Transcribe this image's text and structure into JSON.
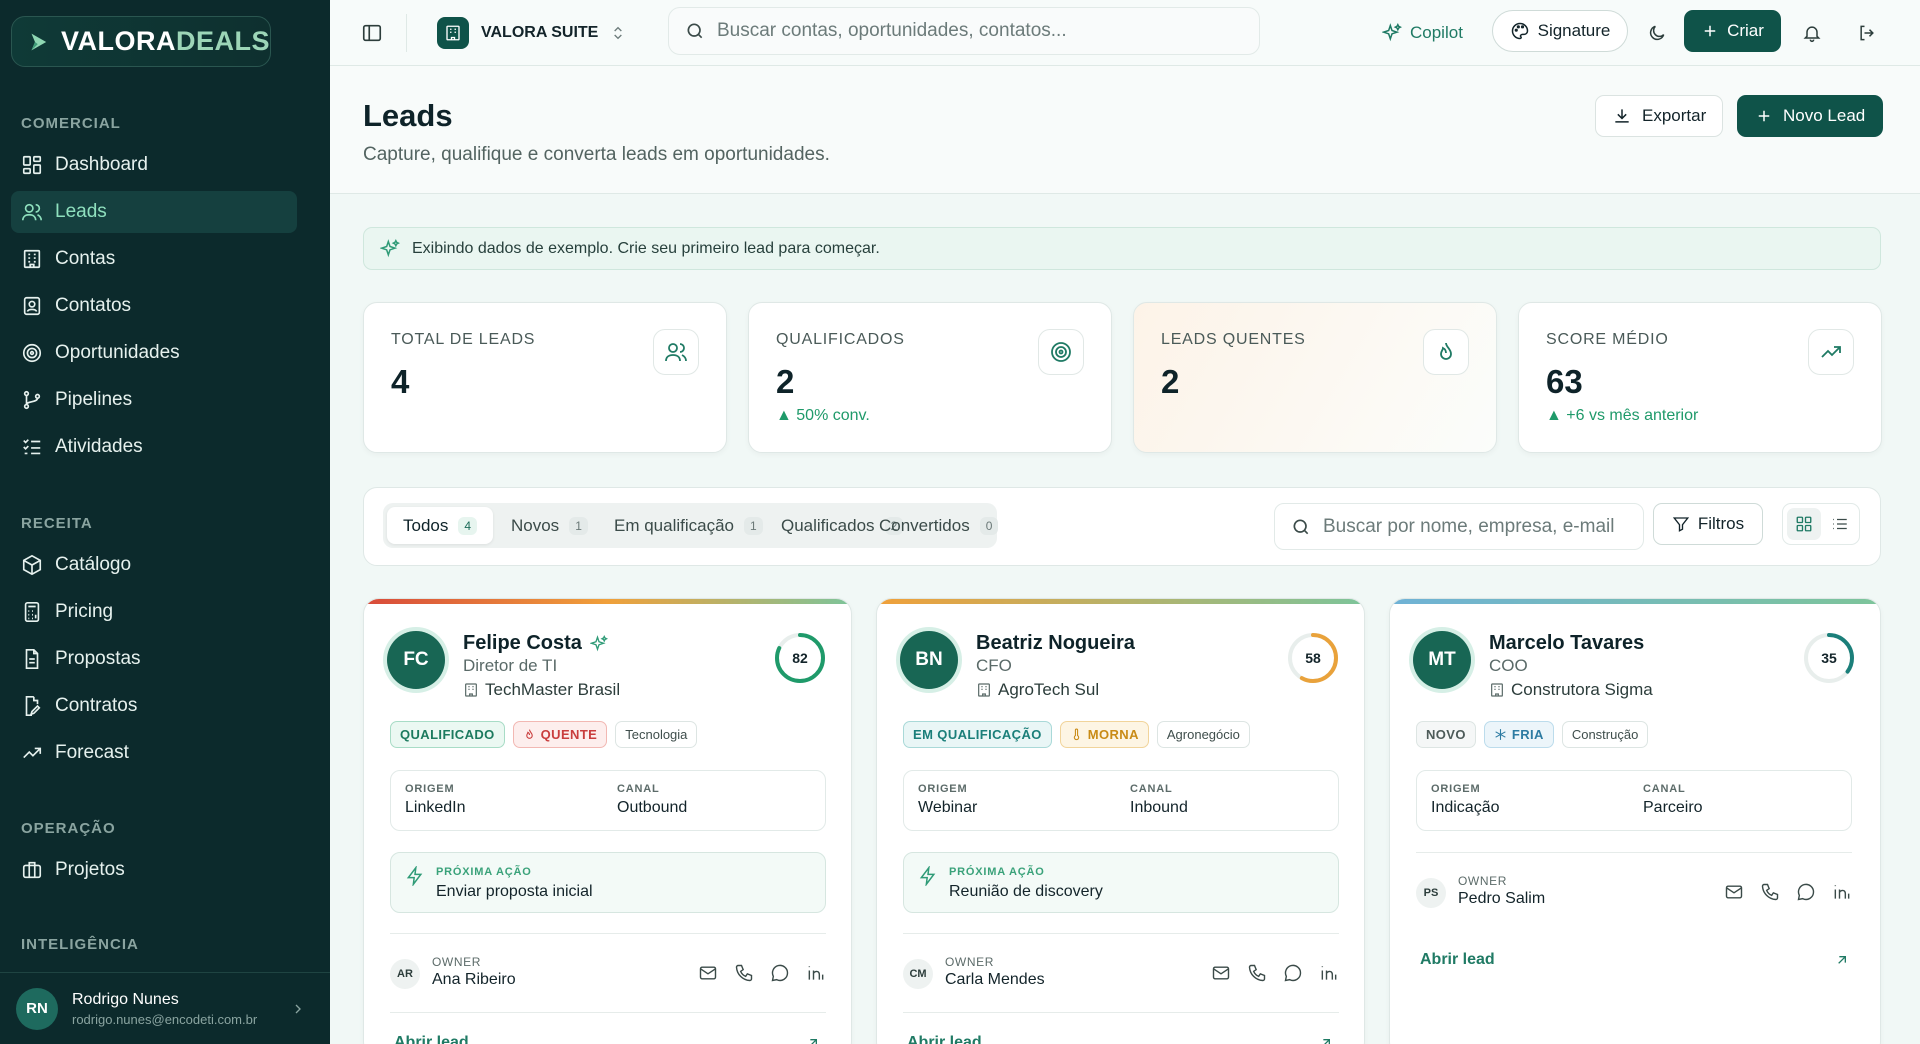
{
  "brand": {
    "logo_part1": "VALORA",
    "logo_part2": "DEALS"
  },
  "sidebar": {
    "sections": [
      {
        "title": "COMERCIAL"
      },
      {
        "title": "RECEITA"
      },
      {
        "title": "OPERAÇÃO"
      },
      {
        "title": "INTELIGÊNCIA"
      }
    ],
    "items": [
      {
        "label": "Dashboard",
        "icon": "grid-icon"
      },
      {
        "label": "Leads",
        "icon": "users-icon",
        "active": true
      },
      {
        "label": "Contas",
        "icon": "building-icon"
      },
      {
        "label": "Contatos",
        "icon": "contact-icon"
      },
      {
        "label": "Oportunidades",
        "icon": "target-icon"
      },
      {
        "label": "Pipelines",
        "icon": "git-branch-icon"
      },
      {
        "label": "Atividades",
        "icon": "list-checks-icon"
      },
      {
        "label": "Catálogo",
        "icon": "package-icon"
      },
      {
        "label": "Pricing",
        "icon": "calculator-icon"
      },
      {
        "label": "Propostas",
        "icon": "file-text-icon"
      },
      {
        "label": "Contratos",
        "icon": "file-edit-icon"
      },
      {
        "label": "Forecast",
        "icon": "trending-up-icon"
      },
      {
        "label": "Projetos",
        "icon": "briefcase-icon"
      }
    ],
    "user": {
      "initials": "RN",
      "name": "Rodrigo Nunes",
      "email": "rodrigo.nunes@encodeti.com.br"
    }
  },
  "topbar": {
    "suite": "VALORA SUITE",
    "search_placeholder": "Buscar contas, oportunidades, contatos...",
    "copilot": "Copilot",
    "signature": "Signature",
    "create": "Criar"
  },
  "page": {
    "title": "Leads",
    "subtitle": "Capture, qualifique e converta leads em oportunidades.",
    "export": "Exportar",
    "new_lead": "Novo Lead",
    "banner": "Exibindo dados de exemplo. Crie seu primeiro lead para começar."
  },
  "stats": [
    {
      "label": "TOTAL DE LEADS",
      "value": "4",
      "note": "",
      "icon": "users-icon"
    },
    {
      "label": "QUALIFICADOS",
      "value": "2",
      "note": "▲ 50% conv.",
      "icon": "target-icon"
    },
    {
      "label": "LEADS QUENTES",
      "value": "2",
      "note": "",
      "icon": "flame-icon"
    },
    {
      "label": "SCORE MÉDIO",
      "value": "63",
      "note": "▲ +6 vs mês anterior",
      "icon": "trending-up-icon"
    }
  ],
  "tabs": [
    {
      "label": "Todos",
      "count": "4",
      "active": true
    },
    {
      "label": "Novos",
      "count": "1"
    },
    {
      "label": "Em qualificação",
      "count": "1"
    },
    {
      "label": "Qualificados",
      "count": "2"
    },
    {
      "label": "Convertidos",
      "count": "0"
    }
  ],
  "filters": {
    "search_placeholder": "Buscar por nome, empresa, e-mail",
    "filter_label": "Filtros"
  },
  "leads": [
    {
      "initials": "FC",
      "name": "Felipe Costa",
      "role": "Diretor de TI",
      "company": "TechMaster Brasil",
      "score": 82,
      "score_fraction": 0.82,
      "score_color": "#1f9a6a",
      "status": "QUALIFICADO",
      "temperature": "QUENTE",
      "industry": "Tecnologia",
      "origin_label": "ORIGEM",
      "origin": "LinkedIn",
      "channel_label": "CANAL",
      "channel": "Outbound",
      "next_label": "PRÓXIMA AÇÃO",
      "next_action": "Enviar proposta inicial",
      "owner_label": "OWNER",
      "owner_initials": "AR",
      "owner": "Ana Ribeiro",
      "open_label": "Abrir lead"
    },
    {
      "initials": "BN",
      "name": "Beatriz Nogueira",
      "role": "CFO",
      "company": "AgroTech Sul",
      "score": 58,
      "score_fraction": 0.58,
      "score_color": "#e9a23b",
      "status": "EM QUALIFICAÇÃO",
      "temperature": "MORNA",
      "industry": "Agronegócio",
      "origin_label": "ORIGEM",
      "origin": "Webinar",
      "channel_label": "CANAL",
      "channel": "Inbound",
      "next_label": "PRÓXIMA AÇÃO",
      "next_action": "Reunião de discovery",
      "owner_label": "OWNER",
      "owner_initials": "CM",
      "owner": "Carla Mendes",
      "open_label": "Abrir lead"
    },
    {
      "initials": "MT",
      "name": "Marcelo Tavares",
      "role": "COO",
      "company": "Construtora Sigma",
      "score": 35,
      "score_fraction": 0.35,
      "score_color": "#1b7f7a",
      "status": "NOVO",
      "temperature": "FRIA",
      "industry": "Construção",
      "origin_label": "ORIGEM",
      "origin": "Indicação",
      "channel_label": "CANAL",
      "channel": "Parceiro",
      "owner_label": "OWNER",
      "owner_initials": "PS",
      "owner": "Pedro Salim",
      "open_label": "Abrir lead"
    }
  ],
  "colors": {
    "accent": "#0f5349",
    "sidebar_bg": "#0c2a2c",
    "success": "#1f9a6a"
  }
}
